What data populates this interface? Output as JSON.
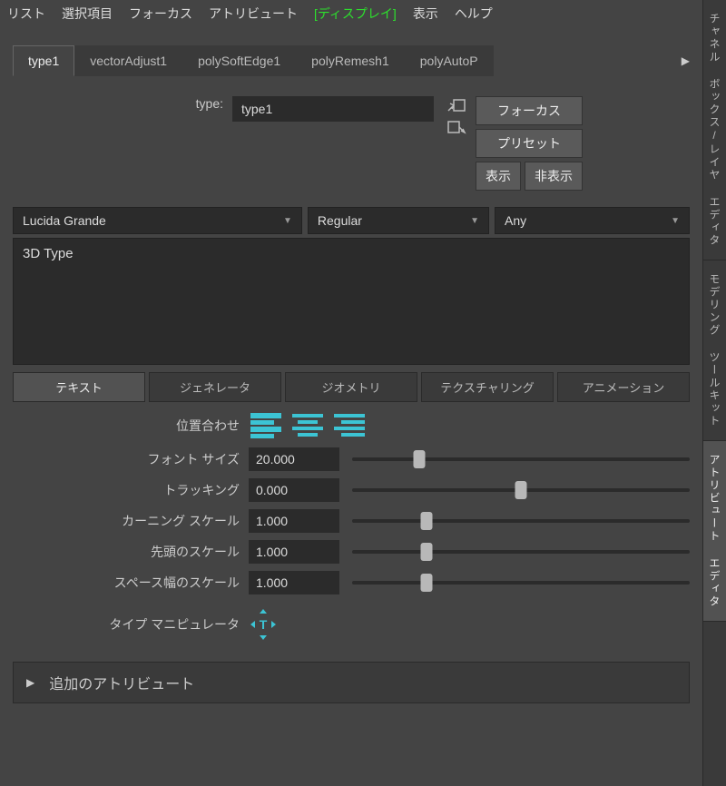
{
  "menubar": [
    "リスト",
    "選択項目",
    "フォーカス",
    "アトリビュート",
    "ディスプレイ",
    "表示",
    "ヘルプ"
  ],
  "menubar_highlight_index": 4,
  "tabs": {
    "items": [
      "type1",
      "vectorAdjust1",
      "polySoftEdge1",
      "polyRemesh1",
      "polyAutoP"
    ],
    "active": 0
  },
  "type_section": {
    "label": "type:",
    "value": "type1",
    "buttons": {
      "focus": "フォーカス",
      "preset": "プリセット",
      "show": "表示",
      "hide": "非表示"
    }
  },
  "dropdowns": {
    "font": "Lucida Grande",
    "weight": "Regular",
    "lang": "Any"
  },
  "text_content": "3D Type",
  "subtabs": {
    "items": [
      "テキスト",
      "ジェネレータ",
      "ジオメトリ",
      "テクスチャリング",
      "アニメーション"
    ],
    "active": 0
  },
  "align": {
    "label": "位置合わせ"
  },
  "sliders": [
    {
      "label": "フォント サイズ",
      "value": "20.000",
      "pos": 20
    },
    {
      "label": "トラッキング",
      "value": "0.000",
      "pos": 50
    },
    {
      "label": "カーニング スケール",
      "value": "1.000",
      "pos": 22
    },
    {
      "label": "先頭のスケール",
      "value": "1.000",
      "pos": 22
    },
    {
      "label": "スペース幅のスケール",
      "value": "1.000",
      "pos": 22
    }
  ],
  "manipulator": {
    "label": "タイプ マニピュレータ"
  },
  "collapse": {
    "label": "追加のアトリビュート"
  },
  "side_tabs": {
    "items": [
      "チャネル ボックス/レイヤ エディタ",
      "モデリング ツールキット",
      "アトリビュート エディタ"
    ],
    "active": 2
  }
}
